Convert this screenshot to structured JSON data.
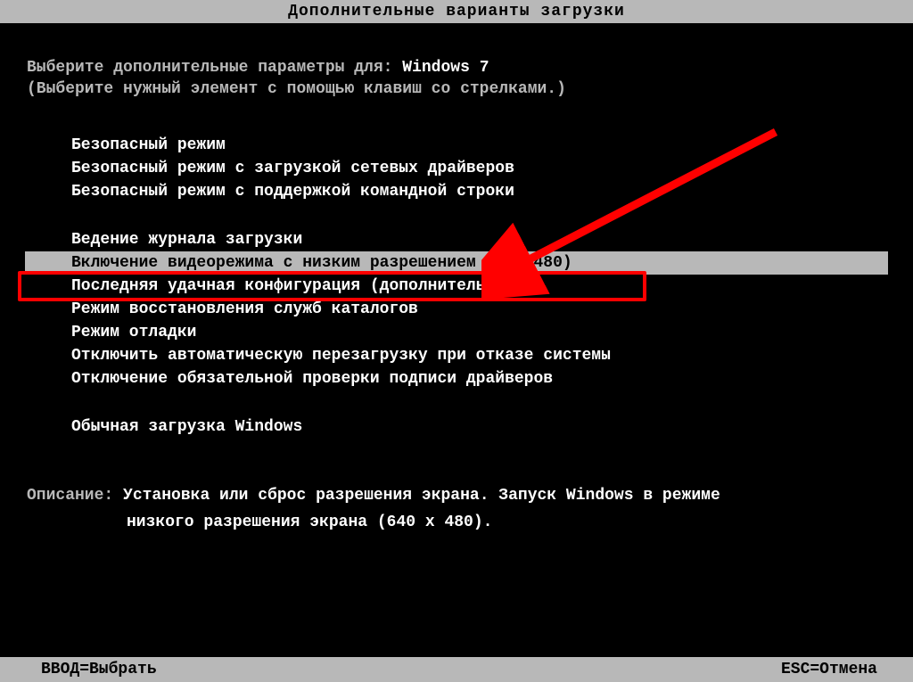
{
  "title": "Дополнительные варианты загрузки",
  "prompt_prefix": "Выберите дополнительные параметры для: ",
  "os_name": "Windows 7",
  "hint": "(Выберите нужный элемент с помощью клавиш со стрелками.)",
  "menu": {
    "items": [
      "Безопасный режим",
      "Безопасный режим с загрузкой сетевых драйверов",
      "Безопасный режим с поддержкой командной строки",
      "Ведение журнала загрузки",
      "Включение видеорежима с низким разрешением (640x480)",
      "Последняя удачная конфигурация (дополнительно)",
      "Режим восстановления служб каталогов",
      "Режим отладки",
      "Отключить автоматическую перезагрузку при отказе системы",
      "Отключение обязательной проверки подписи драйверов",
      "Обычная загрузка Windows"
    ],
    "selected_index": 4
  },
  "description": {
    "label": "Описание:",
    "line1": "Установка или сброс разрешения экрана. Запуск Windows в режиме",
    "line2": "низкого разрешения экрана (640 x 480)."
  },
  "footer": {
    "left": "ВВОД=Выбрать",
    "right": "ESC=Отмена"
  }
}
